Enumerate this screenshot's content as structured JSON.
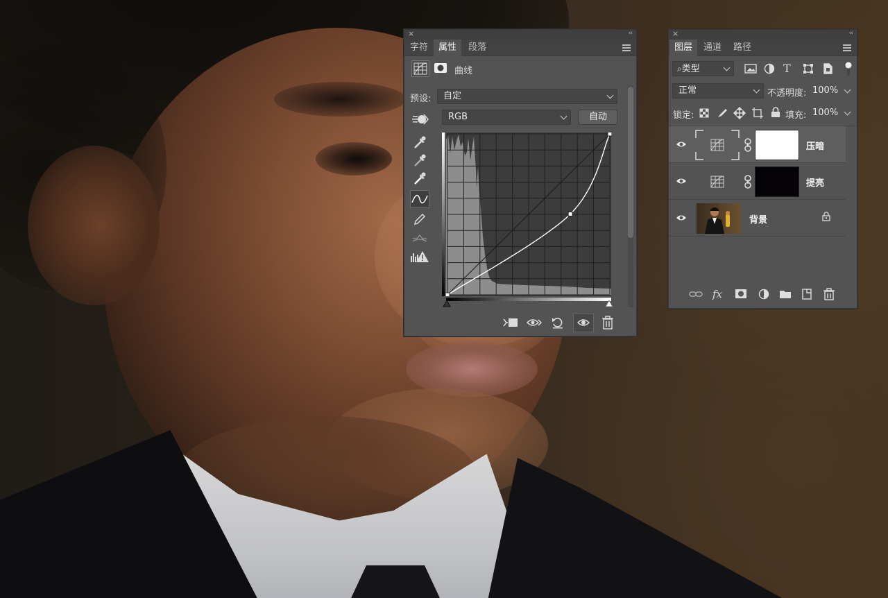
{
  "colors": {
    "panel_bg": "#535353",
    "tabbar_bg": "#424242",
    "selected_layer_bg": "#5e5e5e",
    "curve_line": "#ffffff"
  },
  "properties_panel": {
    "close_icon": "×",
    "collapse_icon": "‹‹",
    "tabs": [
      {
        "label": "字符",
        "active": false
      },
      {
        "label": "属性",
        "active": true
      },
      {
        "label": "段落",
        "active": false
      }
    ],
    "header_title": "曲线",
    "preset_label": "预设:",
    "preset_value": "自定",
    "channel_value": "RGB",
    "auto_button": "自动",
    "curve": {
      "points": [
        [
          0,
          0
        ],
        [
          193,
          128
        ],
        [
          255,
          255
        ]
      ],
      "adjustment_type": "curves"
    }
  },
  "layers_panel": {
    "close_icon": "×",
    "collapse_icon": "‹‹",
    "tabs": [
      {
        "label": "图层",
        "active": true
      },
      {
        "label": "通道",
        "active": false
      },
      {
        "label": "路径",
        "active": false
      }
    ],
    "filter_kind": "类型",
    "blend_mode": "正常",
    "opacity_label": "不透明度:",
    "opacity_value": "100%",
    "lock_label": "锁定:",
    "fill_label": "填充:",
    "fill_value": "100%",
    "layers": [
      {
        "name": "压暗",
        "visible": true,
        "selected": true,
        "type": "curves-adjustment",
        "mask": "white"
      },
      {
        "name": "提亮",
        "visible": true,
        "selected": false,
        "type": "curves-adjustment",
        "mask": "black"
      },
      {
        "name": "背景",
        "visible": true,
        "selected": false,
        "type": "photo",
        "locked": true
      }
    ],
    "bottom_fx": "fx"
  }
}
